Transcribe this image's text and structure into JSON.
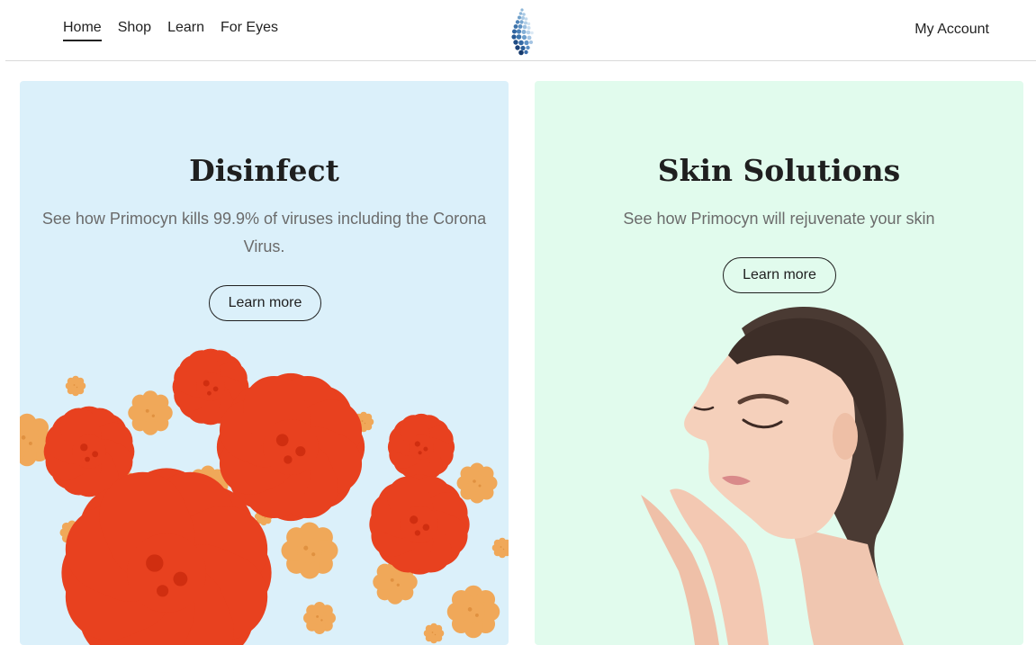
{
  "nav": {
    "items": [
      {
        "label": "Home",
        "active": true
      },
      {
        "label": "Shop"
      },
      {
        "label": "Learn"
      },
      {
        "label": "For Eyes"
      }
    ],
    "logo_icon": "droplet-dots-logo",
    "account_label": "My Account"
  },
  "cards": [
    {
      "title": "Disinfect",
      "text": "See how Primocyn kills 99.9% of viruses including the Corona Virus.",
      "button": "Learn more",
      "background": "#dbf0fa",
      "art": "virus-illustration"
    },
    {
      "title": "Skin Solutions",
      "text": "See how Primocyn will rejuvenate your skin",
      "button": "Learn more",
      "background": "#e1fbed",
      "art": "woman-portrait"
    }
  ],
  "colors": {
    "virus_red": "#e8411f",
    "virus_orange": "#f0a859",
    "logo_blue": "#2e6aa8"
  }
}
